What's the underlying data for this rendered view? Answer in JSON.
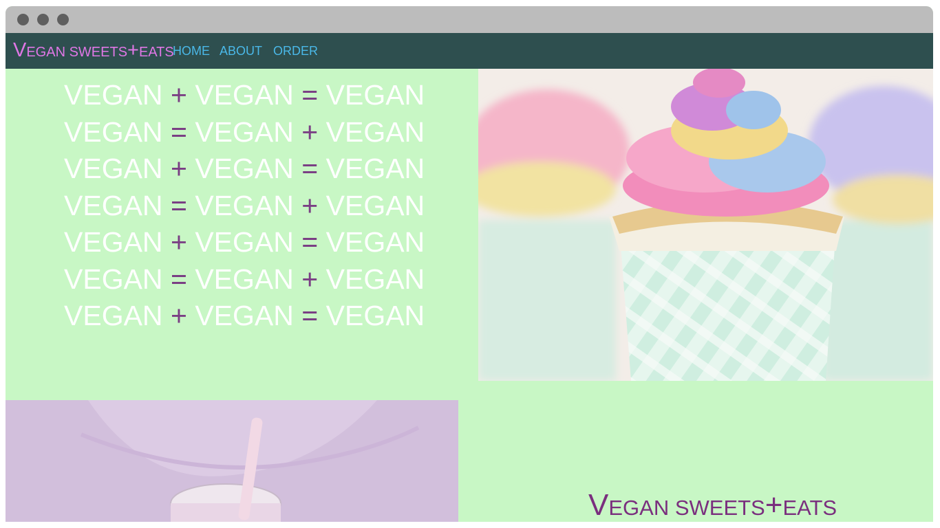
{
  "window": {
    "controls": [
      "close-dot",
      "minimize-dot",
      "maximize-dot"
    ]
  },
  "nav": {
    "brand_first": "V",
    "brand_rest": "EGAN SWEETS",
    "brand_plus": "+",
    "brand_end": "EATS",
    "links": [
      "HOME",
      "ABOUT",
      "ORDER"
    ]
  },
  "hero": {
    "lines": [
      [
        "VEGAN",
        "+",
        "VEGAN",
        "=",
        "VEGAN"
      ],
      [
        "VEGAN",
        "=",
        "VEGAN",
        "+",
        "VEGAN"
      ],
      [
        "VEGAN",
        "+",
        "VEGAN",
        "=",
        "VEGAN"
      ],
      [
        "VEGAN",
        "=",
        "VEGAN",
        "+",
        "VEGAN"
      ],
      [
        "VEGAN",
        "+",
        "VEGAN",
        "=",
        "VEGAN"
      ],
      [
        "VEGAN",
        "=",
        "VEGAN",
        "+",
        "VEGAN"
      ],
      [
        "VEGAN",
        "+",
        "VEGAN",
        "=",
        "VEGAN"
      ]
    ]
  },
  "footer_brand": {
    "first": "V",
    "rest": "EGAN SWEETS",
    "plus": "+",
    "end": "EATS"
  },
  "colors": {
    "page_bg": "#c8f7c5",
    "nav_bg": "#2e4f4f",
    "brand": "#e077e6",
    "link": "#4ab8e8",
    "operator": "#7a3f84",
    "footer_brand": "#7a2f7e"
  },
  "images": [
    "rainbow-cupcake-photo",
    "smoothie-jar-photo"
  ]
}
